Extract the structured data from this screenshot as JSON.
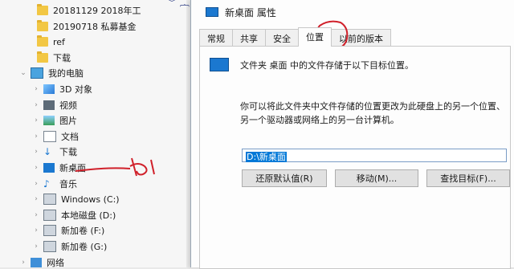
{
  "explorer": {
    "items": [
      {
        "label": "20181129 2018年工",
        "icon": "folder-icon",
        "kind": "folder"
      },
      {
        "label": "20190718 私募基金",
        "icon": "folder-icon",
        "kind": "folder"
      },
      {
        "label": "ref",
        "icon": "folder-icon",
        "kind": "folder"
      },
      {
        "label": "下载",
        "icon": "folder-icon",
        "kind": "folder"
      },
      {
        "label": "我的电脑",
        "icon": "computer-icon",
        "kind": "pc"
      },
      {
        "label": "3D 对象",
        "icon": "3d-objects-icon",
        "kind": "cube"
      },
      {
        "label": "视频",
        "icon": "video-icon",
        "kind": "film"
      },
      {
        "label": "图片",
        "icon": "pictures-icon",
        "kind": "img"
      },
      {
        "label": "文档",
        "icon": "documents-icon",
        "kind": "doc"
      },
      {
        "label": "下载",
        "icon": "downloads-icon",
        "kind": "down"
      },
      {
        "label": "新桌面",
        "icon": "desktop-icon",
        "kind": "desk"
      },
      {
        "label": "音乐",
        "icon": "music-icon",
        "kind": "music"
      },
      {
        "label": "Windows (C:)",
        "icon": "drive-c-icon",
        "kind": "drive"
      },
      {
        "label": "本地磁盘 (D:)",
        "icon": "drive-d-icon",
        "kind": "drive"
      },
      {
        "label": "新加卷 (F:)",
        "icon": "drive-f-icon",
        "kind": "drive"
      },
      {
        "label": "新加卷 (G:)",
        "icon": "drive-g-icon",
        "kind": "drive"
      },
      {
        "label": "网络",
        "icon": "network-icon",
        "kind": "net"
      }
    ]
  },
  "dialog": {
    "title": "新桌面 属性",
    "tabs": [
      "常规",
      "共享",
      "安全",
      "位置",
      "以前的版本"
    ],
    "active_tab": "位置",
    "header_text": "文件夹 桌面 中的文件存储于以下目标位置。",
    "description": "你可以将此文件夹中文件存储的位置更改为此硬盘上的另一个位置、另一个驱动器或网络上的另一台计算机。",
    "path_value": "D:\\新桌面",
    "buttons": {
      "restore": "还原默认值(R)",
      "move": "移动(M)...",
      "find": "查找目标(F)..."
    }
  },
  "colors": {
    "accent": "#0078d7",
    "annotation_red": "#d0202a"
  }
}
